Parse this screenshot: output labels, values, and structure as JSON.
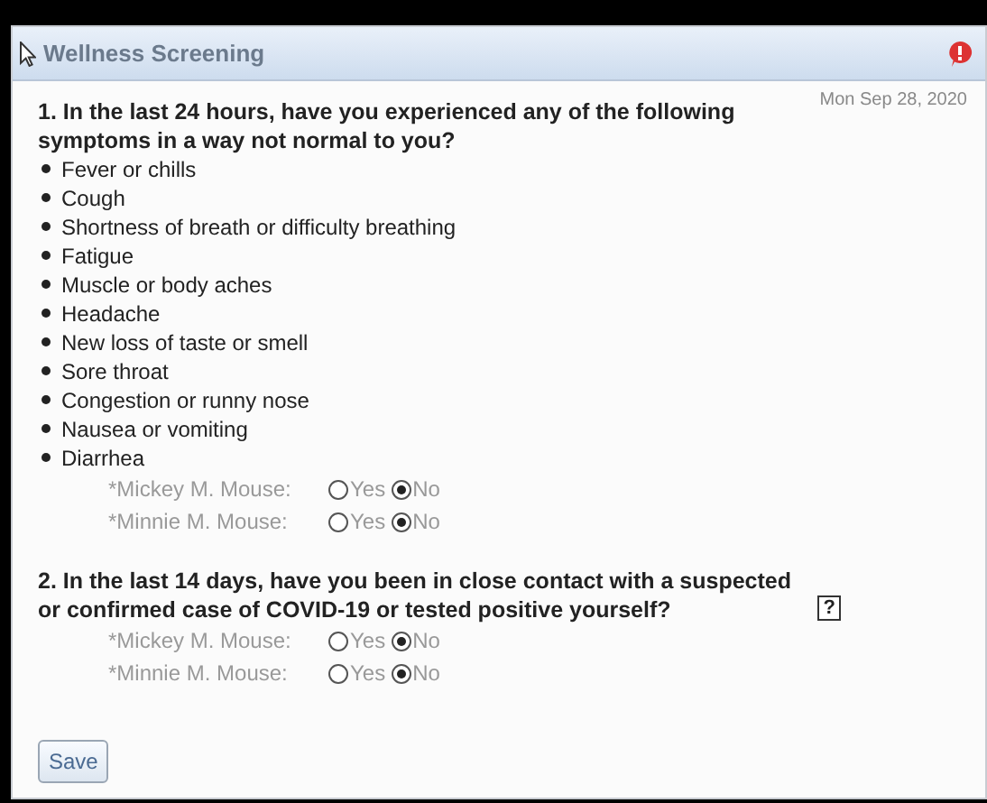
{
  "panel": {
    "title": "Wellness Screening",
    "date": "Mon Sep 28, 2020"
  },
  "questions": [
    {
      "text": "1. In the last 24 hours, have you experienced any of the following symptoms in a way not normal to you?",
      "symptoms": [
        "Fever or chills",
        "Cough",
        "Shortness of breath or difficulty breathing",
        "Fatigue",
        "Muscle or body aches",
        "Headache",
        "New loss of taste or smell",
        "Sore throat",
        "Congestion or runny nose",
        "Nausea or vomiting",
        "Diarrhea"
      ],
      "responses": [
        {
          "name": "*Mickey M. Mouse:",
          "options": [
            {
              "label": "Yes",
              "selected": false
            },
            {
              "label": "No",
              "selected": true
            }
          ]
        },
        {
          "name": "*Minnie M. Mouse:",
          "options": [
            {
              "label": "Yes",
              "selected": false
            },
            {
              "label": "No",
              "selected": true
            }
          ]
        }
      ]
    },
    {
      "text": "2. In the last 14 days, have you been in close contact with a suspected or confirmed case of COVID-19 or tested positive yourself?",
      "help": "?",
      "responses": [
        {
          "name": "*Mickey M. Mouse:",
          "options": [
            {
              "label": "Yes",
              "selected": false
            },
            {
              "label": "No",
              "selected": true
            }
          ]
        },
        {
          "name": "*Minnie M. Mouse:",
          "options": [
            {
              "label": "Yes",
              "selected": false
            },
            {
              "label": "No",
              "selected": true
            }
          ]
        }
      ]
    }
  ],
  "buttons": [
    "Save"
  ]
}
